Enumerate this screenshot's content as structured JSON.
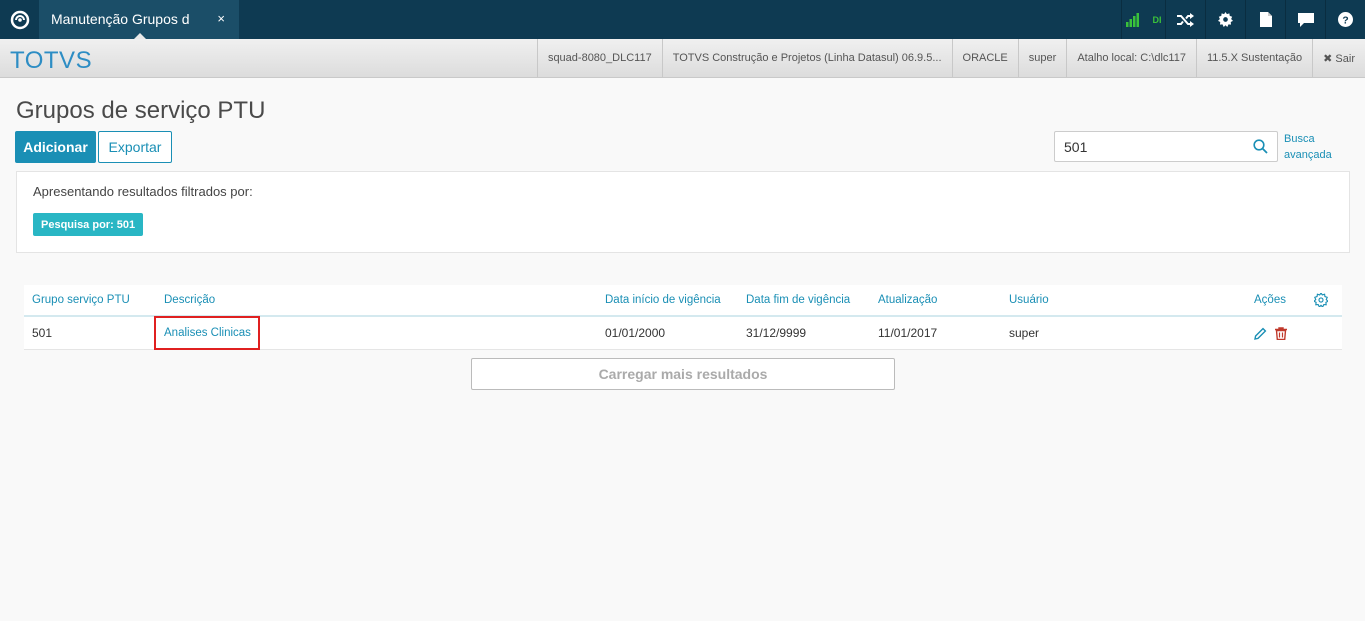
{
  "topbar": {
    "tab_label": "Manutenção Grupos d",
    "tab_close": "×",
    "signal_label": "DI",
    "icons": [
      "logo-icon",
      "signal-icon",
      "shuffle-icon",
      "gear-icon",
      "file-icon",
      "chat-icon",
      "help-icon"
    ]
  },
  "subbar": {
    "brand": "TOTVS",
    "items": [
      "squad-8080_DLC117",
      "TOTVS Construção e Projetos (Linha Datasul) 06.9.5...",
      "ORACLE",
      "super",
      "Atalho local: C:\\dlc117",
      "11.5.X Sustentação"
    ],
    "logout": "✖ Sair"
  },
  "page": {
    "title": "Grupos de serviço PTU",
    "add_button": "Adicionar",
    "export_button": "Exportar",
    "search_value": "501",
    "advanced_search_line1": "Busca",
    "advanced_search_line2": "avançada"
  },
  "filter": {
    "label": "Apresentando resultados filtrados por:",
    "badge": "Pesquisa por: 501"
  },
  "grid": {
    "headers": [
      "Grupo serviço PTU",
      "Descrição",
      "Data início de vigência",
      "Data fim de vigência",
      "Atualização",
      "Usuário",
      "Ações"
    ],
    "rows": [
      {
        "grupo": "501",
        "descricao": "Analises Clinicas",
        "inicio": "01/01/2000",
        "fim": "31/12/9999",
        "atualizacao": "11/01/2017",
        "usuario": "super"
      }
    ],
    "load_more": "Carregar mais resultados"
  },
  "colors": {
    "topbar": "#0e3a52",
    "accent": "#1a8fb5",
    "badge": "#29b6c4",
    "highlight": "#e02020",
    "delete": "#c0392b",
    "signal": "#3ac13a"
  }
}
